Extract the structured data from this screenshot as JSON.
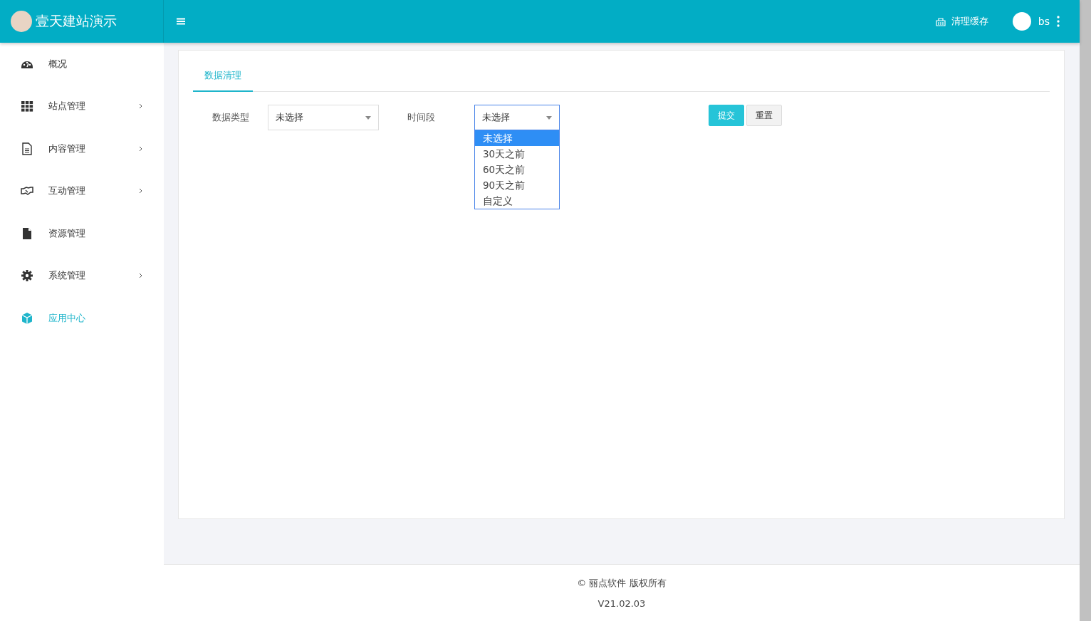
{
  "header": {
    "site_title": "壹天建站演示",
    "clear_cache": "清理缓存",
    "user": "bs"
  },
  "sidebar": {
    "items": [
      {
        "label": "概况",
        "has_submenu": false,
        "selected": false
      },
      {
        "label": "站点管理",
        "has_submenu": true,
        "selected": false
      },
      {
        "label": "内容管理",
        "has_submenu": true,
        "selected": false
      },
      {
        "label": "互动管理",
        "has_submenu": true,
        "selected": false
      },
      {
        "label": "资源管理",
        "has_submenu": false,
        "selected": false
      },
      {
        "label": "系统管理",
        "has_submenu": true,
        "selected": false
      },
      {
        "label": "应用中心",
        "has_submenu": false,
        "selected": true
      }
    ]
  },
  "tabs": [
    {
      "label": "数据清理",
      "selected": true
    }
  ],
  "form": {
    "data_type": {
      "label": "数据类型",
      "value": "未选择"
    },
    "period": {
      "label": "时间段",
      "value": "未选择",
      "expanded": true,
      "options": [
        {
          "label": "未选择",
          "selected": true
        },
        {
          "label": "30天之前",
          "selected": false
        },
        {
          "label": "60天之前",
          "selected": false
        },
        {
          "label": "90天之前",
          "selected": false
        },
        {
          "label": "自定义",
          "selected": false
        }
      ]
    },
    "buttons": [
      {
        "label": "提交",
        "kind": "primary"
      },
      {
        "label": "重置",
        "kind": "default"
      }
    ]
  },
  "footer": {
    "copyright": "© 丽点软件 版权所有",
    "version": "V21.02.03"
  }
}
